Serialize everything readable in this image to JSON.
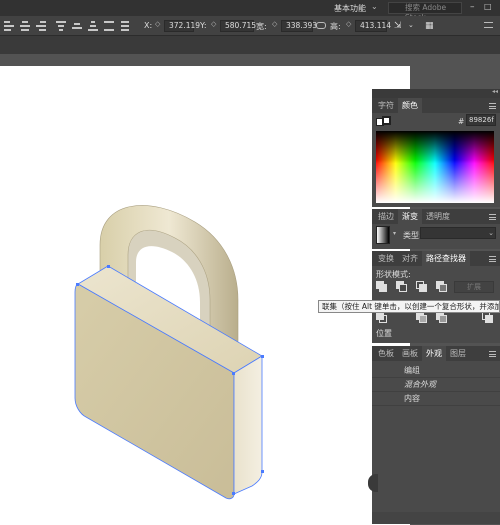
{
  "topbar": {
    "workspace_label": "基本功能",
    "search_placeholder": "搜索 Adobe Stock",
    "minimize": "–",
    "maximize": "□"
  },
  "controlbar": {
    "x_label": "X:",
    "x_value": "372.119",
    "y_label": "Y:",
    "y_value": "580.715",
    "w_label": "宽:",
    "w_value": "338.393",
    "h_label": "高:",
    "h_value": "413.114"
  },
  "color_panel": {
    "tabs": [
      "字符",
      "颜色"
    ],
    "hex_label": "#",
    "hex_value": "89826f"
  },
  "gradient_panel": {
    "tabs": [
      "描边",
      "渐变",
      "透明度"
    ],
    "type_label": "类型:"
  },
  "pathfinder_panel": {
    "tabs": [
      "变换",
      "对齐",
      "路径查找器"
    ],
    "shape_modes_label": "形状模式:",
    "expand_label": "扩展",
    "pathfinders_label": "位置"
  },
  "tooltip": {
    "text": "联集（按住 Alt 键单击，以创建一个复合形状，并添加到形状区域）"
  },
  "appearance_panel": {
    "tabs": [
      "色板",
      "画板",
      "外观",
      "图层"
    ],
    "rows": [
      "编组",
      "混合外观",
      "内容"
    ]
  },
  "colors": {
    "canvas_bg": "#535353",
    "artboard": "#ffffff",
    "lock_face": "#d9cfae",
    "lock_light": "#f1ead6",
    "selection": "#4a7bff"
  },
  "icons": [
    "search-icon",
    "window-minimize-icon",
    "window-maximize-icon",
    "panel-menu-icon",
    "unite-icon",
    "minus-front-icon",
    "intersect-icon",
    "exclude-icon",
    "lock-artwork"
  ]
}
